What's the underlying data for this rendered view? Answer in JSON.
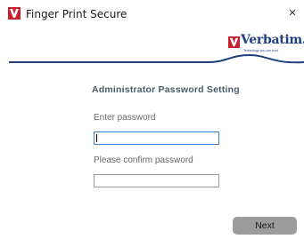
{
  "window": {
    "title": "Finger Print Secure",
    "close_symbol": "×",
    "app_icon": "verbatim-v-icon"
  },
  "brand": {
    "name": "Verbatim.",
    "tagline": "Technology you can trust",
    "color": "#1f3e7a",
    "accent": "#c8202f"
  },
  "form": {
    "heading": "Administrator Password Setting",
    "password_label": "Enter password",
    "password_value": "",
    "confirm_label": "Please confirm password",
    "confirm_value": ""
  },
  "actions": {
    "next_label": "Next"
  }
}
